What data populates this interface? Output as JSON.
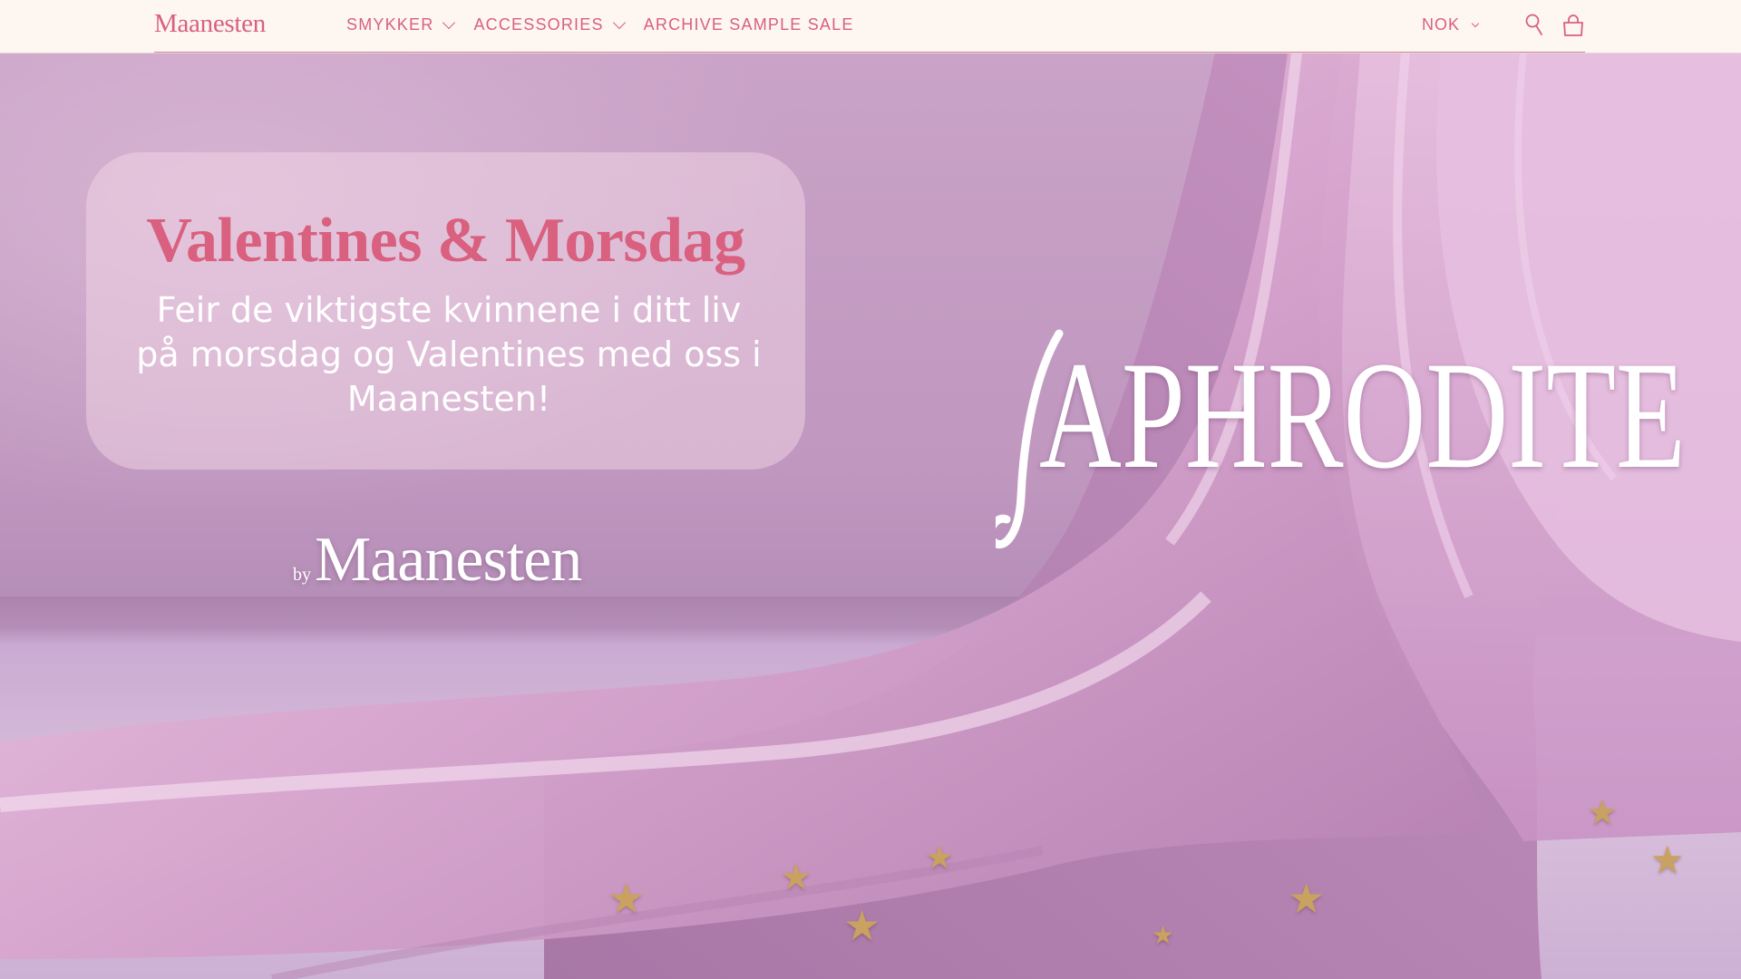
{
  "header": {
    "logo": "Maanesten",
    "nav": [
      {
        "label": "SMYKKER",
        "has_dropdown": true
      },
      {
        "label": "ACCESSORIES",
        "has_dropdown": true
      },
      {
        "label": "ARCHIVE SAMPLE SALE",
        "has_dropdown": false
      }
    ],
    "currency": "NOK",
    "icons": [
      "search-icon",
      "cart-icon"
    ]
  },
  "hero": {
    "title": "Valentines & Morsdag",
    "subtitle": "Feir de viktigste kvinnene i ditt liv på morsdag og Valentines med oss i Maanesten!",
    "by_label": "by",
    "brand": "Maanesten",
    "collection": "APHRODITE"
  },
  "colors": {
    "accent": "#d9607e",
    "header_bg": "#fdf6f1",
    "hero_bg": "#c9a6c8"
  }
}
